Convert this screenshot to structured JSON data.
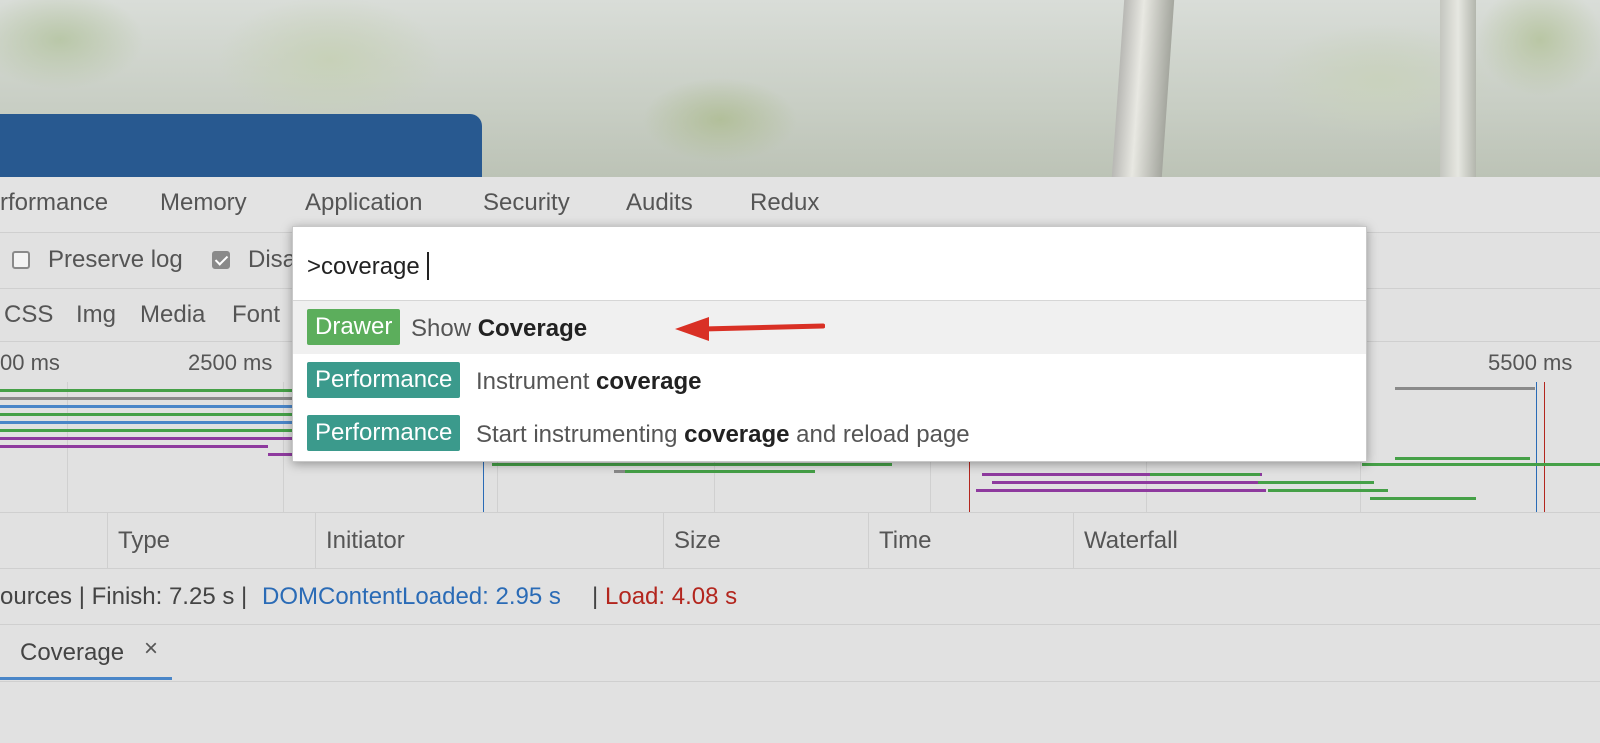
{
  "panel_tabs": [
    "rformance",
    "Memory",
    "Application",
    "Security",
    "Audits",
    "Redux"
  ],
  "toolbar": {
    "preserve_log_label": "Preserve log",
    "preserve_log_checked": false,
    "disable_cache_label": "Disa",
    "disable_cache_checked": true
  },
  "filters": [
    "CSS",
    "Img",
    "Media",
    "Font"
  ],
  "overview": {
    "ticks": [
      "00 ms",
      "2500 ms",
      "5500 ms"
    ]
  },
  "table_columns": [
    "Type",
    "Initiator",
    "Size",
    "Time",
    "Waterfall"
  ],
  "summary": {
    "resources": "ources | Finish: 7.25 s |",
    "dom_content_loaded": "DOMContentLoaded: 2.95 s",
    "separator": "|",
    "load": "Load: 4.08 s",
    "dcl_color": "#2a6bb6",
    "load_color": "#b3261e"
  },
  "drawer": {
    "tab_label": "Coverage",
    "close_glyph": "×"
  },
  "command_menu": {
    "input_value": ">coverage",
    "items": [
      {
        "badge": "Drawer",
        "prefix": "Show ",
        "bold": "Coverage",
        "suffix": ""
      },
      {
        "badge": "Performance",
        "prefix": "Instrument ",
        "bold": "coverage",
        "suffix": ""
      },
      {
        "badge": "Performance",
        "prefix": "Start instrumenting ",
        "bold": "coverage",
        "suffix": " and reload page"
      }
    ],
    "drawer_badge_color": "#5cae5c",
    "performance_badge_color": "#3b9a8c"
  },
  "annotation": {
    "arrow_color": "#d93025",
    "icon": "red-arrow-icon"
  }
}
